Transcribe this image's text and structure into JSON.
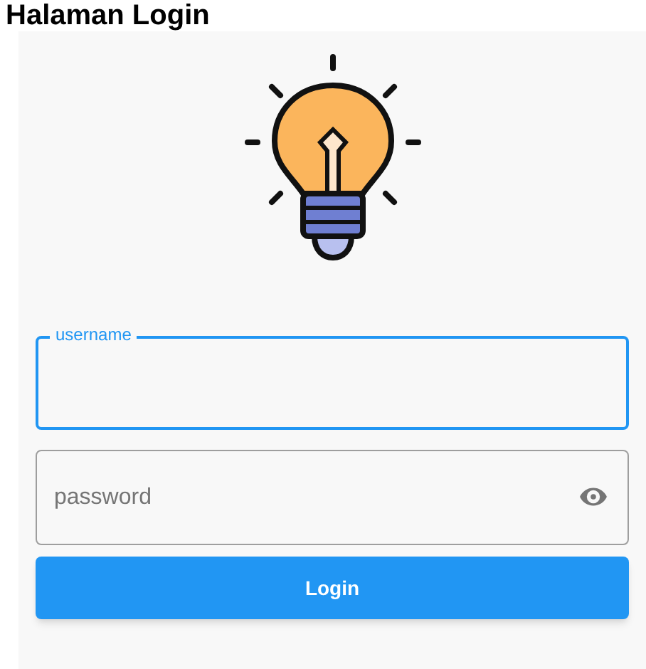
{
  "title": "Halaman Login",
  "username": {
    "label": "username",
    "focused": true
  },
  "password": {
    "placeholder": "password",
    "obscured": true
  },
  "login_button": {
    "label": "Login"
  }
}
